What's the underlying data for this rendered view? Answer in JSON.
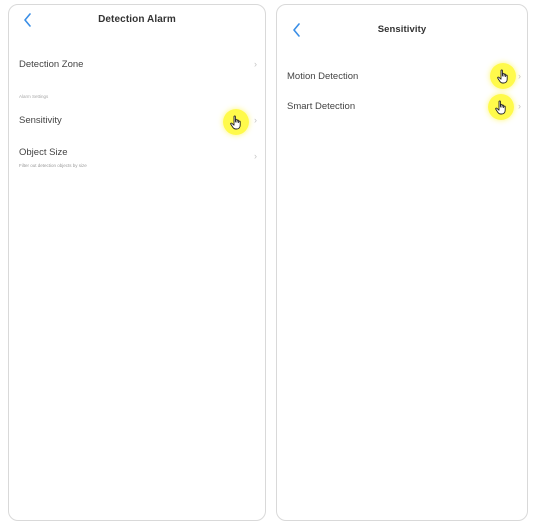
{
  "colors": {
    "accent": "#3a8ee6",
    "tap_highlight": "#fff93c",
    "text_primary": "#444444",
    "text_secondary": "#9a9a9a",
    "chevron": "#c4c4c4"
  },
  "left_screen": {
    "title": "Detection Alarm",
    "back_icon": "chevron-left-icon",
    "rows": {
      "detection_zone": {
        "label": "Detection Zone"
      },
      "section_caption": "Alarm Settings",
      "sensitivity": {
        "label": "Sensitivity"
      },
      "object_size": {
        "label": "Object Size",
        "sub": "Filter out detection objects by size"
      }
    },
    "tap_icon": "pointing-hand-icon"
  },
  "right_screen": {
    "title": "Sensitivity",
    "back_icon": "chevron-left-icon",
    "rows": {
      "motion_detection": {
        "label": "Motion Detection"
      },
      "smart_detection": {
        "label": "Smart Detection"
      }
    },
    "tap_icon": "pointing-hand-icon"
  },
  "chevron_glyph": "›"
}
